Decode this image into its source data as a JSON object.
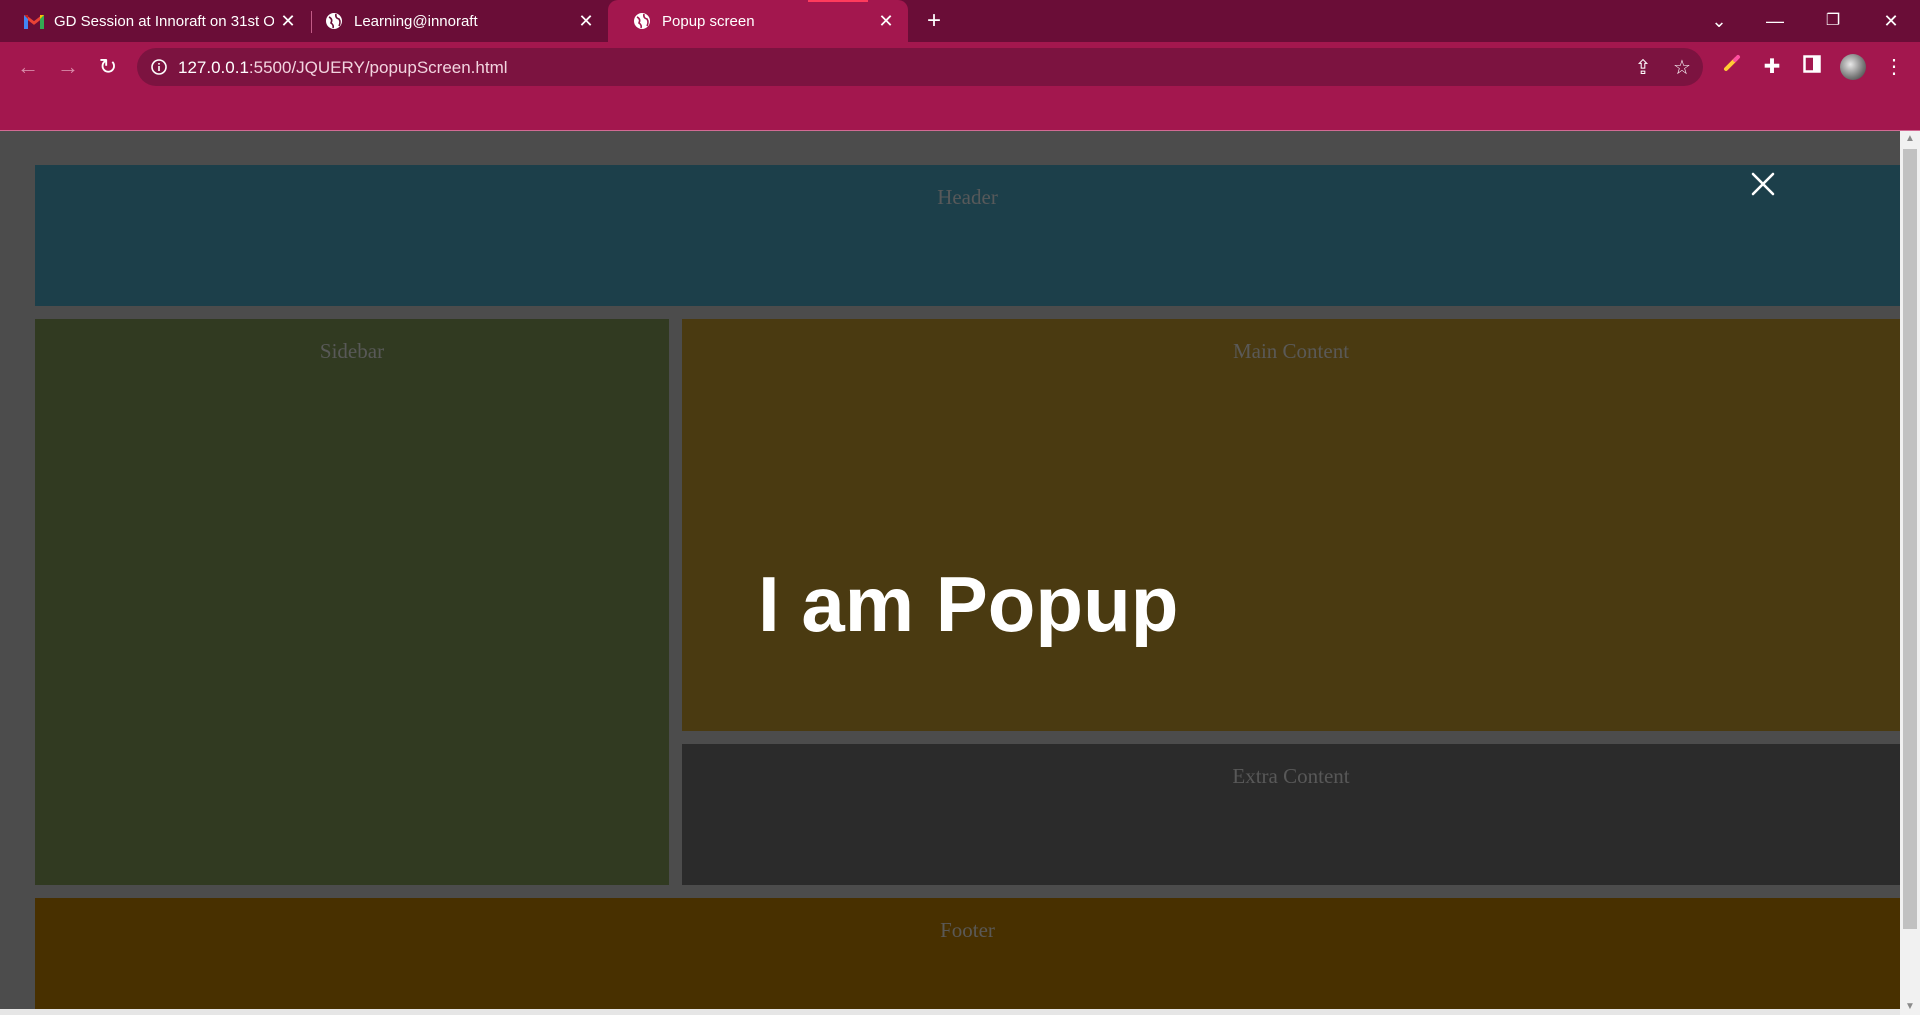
{
  "browser": {
    "tabs": [
      {
        "title": "GD Session at Innoraft on 31st O",
        "icon": "gmail-icon"
      },
      {
        "title": "Learning@innoraft",
        "icon": "globe-icon"
      },
      {
        "title": "Popup screen",
        "icon": "globe-icon",
        "active": true
      }
    ],
    "address": {
      "host": "127.0.0.1",
      "path": ":5500/JQUERY/popupScreen.html"
    },
    "theme_color": "#a3174e"
  },
  "page": {
    "header_label": "Header",
    "sidebar_label": "Sidebar",
    "main_label": "Main Content",
    "extra_label": "Extra Content",
    "footer_label": "Footer",
    "popup_text": "I am Popup",
    "colors": {
      "overlay": "#4c4c4c",
      "header": "#1c3f4a",
      "sidebar": "#313a21",
      "main": "#4a3a11",
      "extra": "#2b2b2b",
      "footer": "#483000"
    }
  }
}
